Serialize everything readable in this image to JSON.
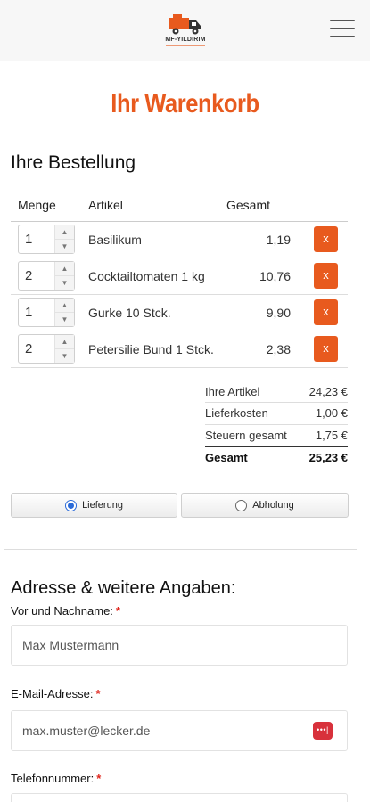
{
  "header": {
    "logo_text": "MF-YILDIRIM",
    "menu_icon": "hamburger-icon"
  },
  "page": {
    "title": "Ihr Warenkorb"
  },
  "order": {
    "heading": "Ihre Bestellung",
    "columns": [
      "Menge",
      "Artikel",
      "Gesamt"
    ],
    "items": [
      {
        "qty": "1",
        "name": "Basilikum",
        "total": "1,19",
        "delete": "x"
      },
      {
        "qty": "2",
        "name": "Cocktailtomaten 1 kg",
        "total": "10,76",
        "delete": "x"
      },
      {
        "qty": "1",
        "name": "Gurke 10 Stck.",
        "total": "9,90",
        "delete": "x"
      },
      {
        "qty": "2",
        "name": "Petersilie Bund 1 Stck.",
        "total": "2,38",
        "delete": "x"
      }
    ]
  },
  "summary": {
    "rows": [
      {
        "label": "Ihre Artikel",
        "value": "24,23 €"
      },
      {
        "label": "Lieferkosten",
        "value": "1,00 €"
      },
      {
        "label": "Steuern gesamt",
        "value": "1,75 €"
      }
    ],
    "total_label": "Gesamt",
    "total_value": "25,23 €"
  },
  "delivery": {
    "option_delivery": "Lieferung",
    "option_pickup": "Abholung",
    "selected": "Lieferung"
  },
  "address": {
    "heading": "Adresse & weitere Angaben:",
    "name_label": "Vor und Nachname:",
    "name_value": "Max Mustermann",
    "email_label": "E-Mail-Adresse:",
    "email_value": "max.muster@lecker.de",
    "phone_label": "Telefonnummer:",
    "required_mark": "*",
    "password_icon_text": "•••|"
  },
  "colors": {
    "accent": "#e85a1e",
    "radio_selected": "#2a6ad8",
    "required": "#e0261d"
  }
}
